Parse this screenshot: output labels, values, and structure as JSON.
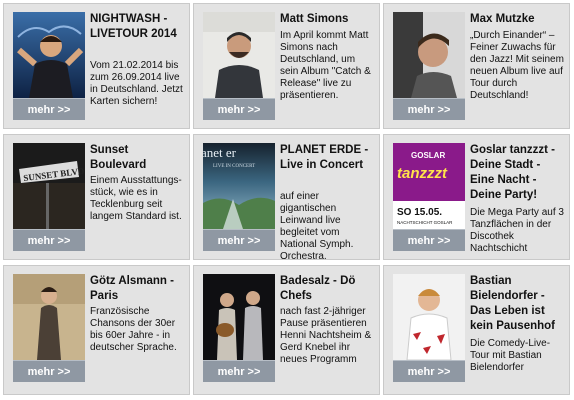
{
  "more_label": "mehr >>",
  "cards": [
    {
      "title": "NIGHTWASH - LIVETOUR 2014",
      "desc": "Vom 21.02.2014 bis zum 26.09.2014 live in Deutschland. Jetzt Karten sichern!"
    },
    {
      "title": "Matt Simons",
      "desc": "Im April kommt Matt Simons nach Deutschland, um sein Album \"Catch & Release\" live zu präsentieren."
    },
    {
      "title": "Max Mutzke",
      "desc": "„Durch Einander“ – Feiner Zuwachs für den Jazz! Mit seinem neuen Album live auf Tour durch Deutschland!"
    },
    {
      "title": "Sunset Boulevard",
      "desc": "Einem Ausstattungs-stück, wie es in Tecklenburg seit langem Standard ist."
    },
    {
      "title": "PLANET ERDE - Live in Concert",
      "desc": "auf einer gigantischen Leinwand live begleitet vom National Symph. Orchestra."
    },
    {
      "title": "Goslar tanzzzt - Deine Stadt - Eine Nacht - Deine Party!",
      "desc": "Die Mega Party auf 3 Tanzflächen in der Discothek Nachtschicht"
    },
    {
      "title": "Götz Alsmann - Paris",
      "desc": "Französische Chansons der 30er bis 60er Jahre - in deutscher Sprache."
    },
    {
      "title": "Badesalz - Dö Chefs",
      "desc": "nach fast 2-jähriger Pause präsentieren Henni Nachtsheim & Gerd Knebel ihr neues Programm"
    },
    {
      "title": "Bastian Bielendorfer - Das Leben ist kein Pausenhof",
      "desc": "Die Comedy-Live-Tour mit Bastian Bielendorfer"
    }
  ],
  "images": {
    "sunset_sign": "SUNSET BLVD",
    "planet_text": "anet er",
    "planet_sub": "LIVE IN CONCERT",
    "goslar_top": "GOSLAR",
    "goslar_word": "tanzzzt",
    "goslar_date": "SO 15.05.",
    "goslar_venue": "NACHTSCHICHT GOSLAR"
  }
}
